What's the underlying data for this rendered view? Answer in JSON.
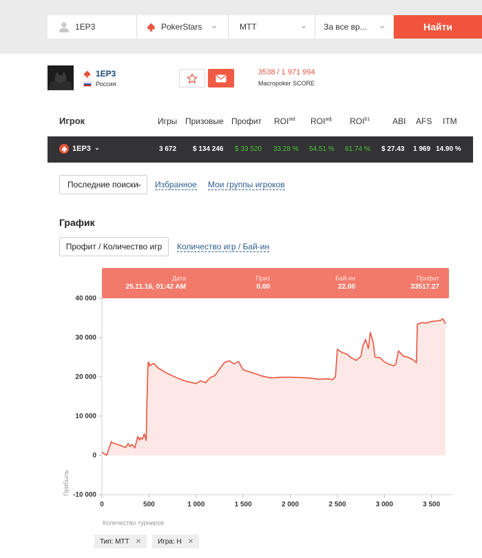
{
  "search": {
    "player_value": "1EP3",
    "room_value": "PokerStars",
    "type_value": "MTT",
    "period_value": "За все вр...",
    "find_label": "Найти"
  },
  "player": {
    "name": "1EP3",
    "country": "Россия",
    "score": "3538 / 1 971 994",
    "score_label": "Macropoker SCORE"
  },
  "table": {
    "headers": {
      "player": "Игрок",
      "games": "Игры",
      "prizes": "Призовые",
      "profit": "Профит",
      "roi": "ROI",
      "roi_std_sup": "std",
      "roi_adj": "ROI",
      "roi_adj_sup": "adj",
      "roi_b": "ROI",
      "roi_b_sup": "b1",
      "abi": "ABI",
      "afs": "AFS",
      "itm": "ITM"
    },
    "row": {
      "name": "1EP3",
      "games": "3 672",
      "prizes": "$ 134 246",
      "profit": "$ 33 520",
      "roi_std": "33.28 %",
      "roi_adj": "54.51 %",
      "roi_b": "61.74 %",
      "abi": "$ 27.43",
      "afs": "1 969",
      "itm": "14.90 %"
    }
  },
  "filters": {
    "recent_label": "Последние поиски",
    "favorites_label": "Избранное",
    "groups_label": "Мои группы игроков"
  },
  "chart_section": {
    "title": "График",
    "tab_active": "Профит / Количество игр",
    "tab_other": "Количество игр / Бай-ин"
  },
  "tooltip": {
    "date_label": "Дата",
    "date_value": "25.11.16, 01:42 AM",
    "prize_label": "Приз",
    "prize_value": "0.00",
    "buyin_label": "Бай-ин",
    "buyin_value": "22.00",
    "profit_label": "Профит",
    "profit_value": "33517.27"
  },
  "tags": {
    "type": "Тип: MTT",
    "game": "Игра: Н"
  },
  "colors": {
    "accent": "#f0543c",
    "line": "#e8533c",
    "fill": "#fde8e5",
    "tooltip": "#f27a6b",
    "green": "#4cc43a",
    "row_bg": "#333335"
  },
  "chart_data": {
    "type": "area",
    "title": "",
    "xlabel": "Количество турниров",
    "ylabel": "Прибыль",
    "xlim": [
      0,
      3700
    ],
    "ylim": [
      -10000,
      40000
    ],
    "x_ticks": [
      0,
      500,
      1000,
      1500,
      2000,
      2500,
      3000,
      3500
    ],
    "x_tick_labels": [
      "0",
      "500",
      "1 000",
      "1 500",
      "2 000",
      "2 500",
      "3 000",
      "3 500"
    ],
    "y_ticks": [
      -10000,
      0,
      10000,
      20000,
      30000,
      40000
    ],
    "y_tick_labels": [
      "-10 000",
      "0",
      "10 000",
      "20 000",
      "30 000",
      "40 000"
    ],
    "grid": false,
    "series": [
      {
        "x": [
          0,
          50,
          100,
          110,
          200,
          250,
          280,
          300,
          320,
          350,
          380,
          400,
          410,
          430,
          450,
          470,
          480,
          490,
          500,
          505,
          550,
          600,
          700,
          800,
          900,
          1000,
          1050,
          1100,
          1150,
          1200,
          1250,
          1300,
          1350,
          1400,
          1450,
          1500,
          1550,
          1600,
          1700,
          1800,
          1900,
          2000,
          2100,
          2200,
          2300,
          2400,
          2450,
          2480,
          2500,
          2550,
          2600,
          2650,
          2700,
          2750,
          2770,
          2800,
          2830,
          2850,
          2880,
          2900,
          2950,
          3000,
          3050,
          3100,
          3120,
          3150,
          3200,
          3250,
          3300,
          3340,
          3350,
          3400,
          3450,
          3500,
          3550,
          3600,
          3620,
          3650
        ],
        "y": [
          800,
          0,
          3500,
          3200,
          2500,
          2000,
          3000,
          2200,
          2800,
          1900,
          4800,
          3900,
          4500,
          4100,
          5500,
          3800,
          15000,
          23500,
          23700,
          22800,
          23400,
          22200,
          20800,
          19700,
          18800,
          18300,
          19000,
          18500,
          19800,
          20300,
          22000,
          23600,
          24100,
          23300,
          23900,
          21800,
          21400,
          21000,
          20200,
          19700,
          19900,
          19900,
          19800,
          19700,
          19400,
          19500,
          19300,
          20000,
          27000,
          26200,
          25800,
          24800,
          24200,
          25200,
          27800,
          29500,
          27200,
          31300,
          28900,
          25000,
          24900,
          23800,
          23200,
          22800,
          23200,
          26600,
          25300,
          25000,
          24400,
          23600,
          33400,
          33800,
          33700,
          34100,
          34200,
          34400,
          34800,
          33500
        ]
      }
    ]
  }
}
